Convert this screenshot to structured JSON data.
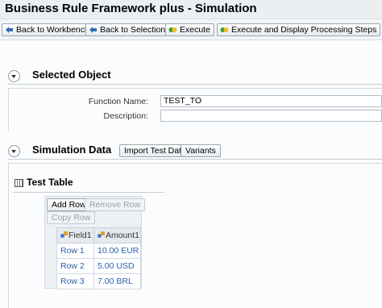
{
  "window": {
    "title": "Business Rule Framework plus - Simulation"
  },
  "toolbar": {
    "back_workbench": "Back to Workbench",
    "back_selection": "Back to Selection",
    "execute": "Execute",
    "execute_display": "Execute and Display Processing Steps"
  },
  "selected_object": {
    "title": "Selected Object",
    "function_name_label": "Function Name:",
    "function_name_value": "TEST_TO",
    "description_label": "Description:",
    "description_value": ""
  },
  "simulation": {
    "title": "Simulation Data",
    "import_label": "Import Test Data",
    "variants_label": "Variants"
  },
  "test_table": {
    "title": "Test Table",
    "add_row": "Add Row",
    "remove_row": "Remove Row",
    "copy_row": "Copy Row",
    "columns": [
      "Field1",
      "Amount1"
    ],
    "rows": [
      [
        "Row 1",
        "10.00 EUR"
      ],
      [
        "Row 2",
        "5.00 USD"
      ],
      [
        "Row 3",
        "7.00 BRL"
      ]
    ]
  },
  "colors": {
    "link": "#2a61a8",
    "toolbar_bg": "#f3f5f7",
    "accent_icon": "#3a7bd5"
  }
}
